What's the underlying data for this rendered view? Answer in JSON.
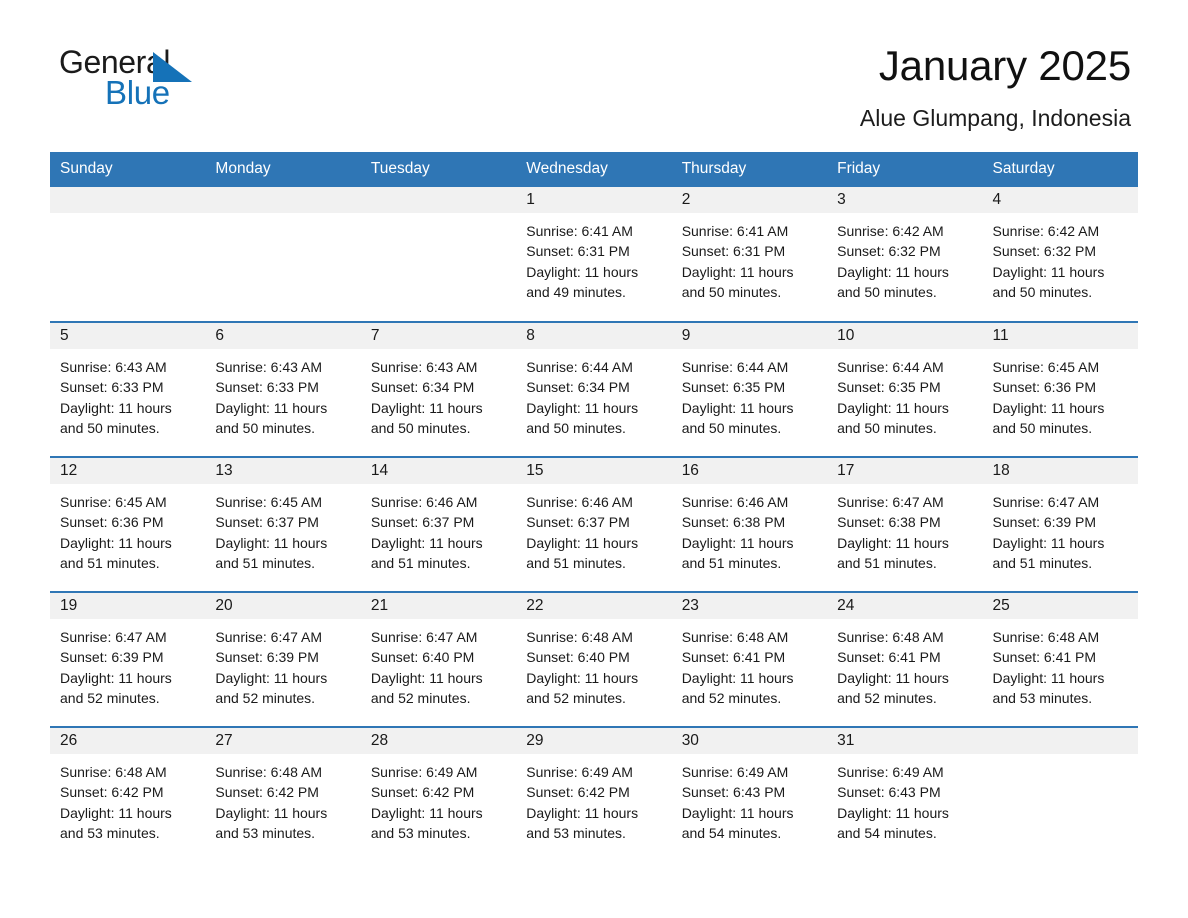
{
  "brand": {
    "name_part1": "General",
    "name_part2": "Blue",
    "triangle_icon": "triangle-icon",
    "accent_color": "#1572b8"
  },
  "header": {
    "month_title": "January 2025",
    "location": "Alue Glumpang, Indonesia",
    "header_bg_color": "#2f76b5",
    "row_divider_color": "#2f76b5",
    "daynum_band_color": "#f1f1f1"
  },
  "weekday_headers": [
    "Sunday",
    "Monday",
    "Tuesday",
    "Wednesday",
    "Thursday",
    "Friday",
    "Saturday"
  ],
  "labels": {
    "sunrise_prefix": "Sunrise:",
    "sunset_prefix": "Sunset:",
    "daylight_prefix": "Daylight:"
  },
  "weeks": [
    [
      {
        "day": "",
        "empty": true
      },
      {
        "day": "",
        "empty": true
      },
      {
        "day": "",
        "empty": true
      },
      {
        "day": "1",
        "sunrise": "Sunrise: 6:41 AM",
        "sunset": "Sunset: 6:31 PM",
        "daylight_line1": "Daylight: 11 hours",
        "daylight_line2": "and 49 minutes."
      },
      {
        "day": "2",
        "sunrise": "Sunrise: 6:41 AM",
        "sunset": "Sunset: 6:31 PM",
        "daylight_line1": "Daylight: 11 hours",
        "daylight_line2": "and 50 minutes."
      },
      {
        "day": "3",
        "sunrise": "Sunrise: 6:42 AM",
        "sunset": "Sunset: 6:32 PM",
        "daylight_line1": "Daylight: 11 hours",
        "daylight_line2": "and 50 minutes."
      },
      {
        "day": "4",
        "sunrise": "Sunrise: 6:42 AM",
        "sunset": "Sunset: 6:32 PM",
        "daylight_line1": "Daylight: 11 hours",
        "daylight_line2": "and 50 minutes."
      }
    ],
    [
      {
        "day": "5",
        "sunrise": "Sunrise: 6:43 AM",
        "sunset": "Sunset: 6:33 PM",
        "daylight_line1": "Daylight: 11 hours",
        "daylight_line2": "and 50 minutes."
      },
      {
        "day": "6",
        "sunrise": "Sunrise: 6:43 AM",
        "sunset": "Sunset: 6:33 PM",
        "daylight_line1": "Daylight: 11 hours",
        "daylight_line2": "and 50 minutes."
      },
      {
        "day": "7",
        "sunrise": "Sunrise: 6:43 AM",
        "sunset": "Sunset: 6:34 PM",
        "daylight_line1": "Daylight: 11 hours",
        "daylight_line2": "and 50 minutes."
      },
      {
        "day": "8",
        "sunrise": "Sunrise: 6:44 AM",
        "sunset": "Sunset: 6:34 PM",
        "daylight_line1": "Daylight: 11 hours",
        "daylight_line2": "and 50 minutes."
      },
      {
        "day": "9",
        "sunrise": "Sunrise: 6:44 AM",
        "sunset": "Sunset: 6:35 PM",
        "daylight_line1": "Daylight: 11 hours",
        "daylight_line2": "and 50 minutes."
      },
      {
        "day": "10",
        "sunrise": "Sunrise: 6:44 AM",
        "sunset": "Sunset: 6:35 PM",
        "daylight_line1": "Daylight: 11 hours",
        "daylight_line2": "and 50 minutes."
      },
      {
        "day": "11",
        "sunrise": "Sunrise: 6:45 AM",
        "sunset": "Sunset: 6:36 PM",
        "daylight_line1": "Daylight: 11 hours",
        "daylight_line2": "and 50 minutes."
      }
    ],
    [
      {
        "day": "12",
        "sunrise": "Sunrise: 6:45 AM",
        "sunset": "Sunset: 6:36 PM",
        "daylight_line1": "Daylight: 11 hours",
        "daylight_line2": "and 51 minutes."
      },
      {
        "day": "13",
        "sunrise": "Sunrise: 6:45 AM",
        "sunset": "Sunset: 6:37 PM",
        "daylight_line1": "Daylight: 11 hours",
        "daylight_line2": "and 51 minutes."
      },
      {
        "day": "14",
        "sunrise": "Sunrise: 6:46 AM",
        "sunset": "Sunset: 6:37 PM",
        "daylight_line1": "Daylight: 11 hours",
        "daylight_line2": "and 51 minutes."
      },
      {
        "day": "15",
        "sunrise": "Sunrise: 6:46 AM",
        "sunset": "Sunset: 6:37 PM",
        "daylight_line1": "Daylight: 11 hours",
        "daylight_line2": "and 51 minutes."
      },
      {
        "day": "16",
        "sunrise": "Sunrise: 6:46 AM",
        "sunset": "Sunset: 6:38 PM",
        "daylight_line1": "Daylight: 11 hours",
        "daylight_line2": "and 51 minutes."
      },
      {
        "day": "17",
        "sunrise": "Sunrise: 6:47 AM",
        "sunset": "Sunset: 6:38 PM",
        "daylight_line1": "Daylight: 11 hours",
        "daylight_line2": "and 51 minutes."
      },
      {
        "day": "18",
        "sunrise": "Sunrise: 6:47 AM",
        "sunset": "Sunset: 6:39 PM",
        "daylight_line1": "Daylight: 11 hours",
        "daylight_line2": "and 51 minutes."
      }
    ],
    [
      {
        "day": "19",
        "sunrise": "Sunrise: 6:47 AM",
        "sunset": "Sunset: 6:39 PM",
        "daylight_line1": "Daylight: 11 hours",
        "daylight_line2": "and 52 minutes."
      },
      {
        "day": "20",
        "sunrise": "Sunrise: 6:47 AM",
        "sunset": "Sunset: 6:39 PM",
        "daylight_line1": "Daylight: 11 hours",
        "daylight_line2": "and 52 minutes."
      },
      {
        "day": "21",
        "sunrise": "Sunrise: 6:47 AM",
        "sunset": "Sunset: 6:40 PM",
        "daylight_line1": "Daylight: 11 hours",
        "daylight_line2": "and 52 minutes."
      },
      {
        "day": "22",
        "sunrise": "Sunrise: 6:48 AM",
        "sunset": "Sunset: 6:40 PM",
        "daylight_line1": "Daylight: 11 hours",
        "daylight_line2": "and 52 minutes."
      },
      {
        "day": "23",
        "sunrise": "Sunrise: 6:48 AM",
        "sunset": "Sunset: 6:41 PM",
        "daylight_line1": "Daylight: 11 hours",
        "daylight_line2": "and 52 minutes."
      },
      {
        "day": "24",
        "sunrise": "Sunrise: 6:48 AM",
        "sunset": "Sunset: 6:41 PM",
        "daylight_line1": "Daylight: 11 hours",
        "daylight_line2": "and 52 minutes."
      },
      {
        "day": "25",
        "sunrise": "Sunrise: 6:48 AM",
        "sunset": "Sunset: 6:41 PM",
        "daylight_line1": "Daylight: 11 hours",
        "daylight_line2": "and 53 minutes."
      }
    ],
    [
      {
        "day": "26",
        "sunrise": "Sunrise: 6:48 AM",
        "sunset": "Sunset: 6:42 PM",
        "daylight_line1": "Daylight: 11 hours",
        "daylight_line2": "and 53 minutes."
      },
      {
        "day": "27",
        "sunrise": "Sunrise: 6:48 AM",
        "sunset": "Sunset: 6:42 PM",
        "daylight_line1": "Daylight: 11 hours",
        "daylight_line2": "and 53 minutes."
      },
      {
        "day": "28",
        "sunrise": "Sunrise: 6:49 AM",
        "sunset": "Sunset: 6:42 PM",
        "daylight_line1": "Daylight: 11 hours",
        "daylight_line2": "and 53 minutes."
      },
      {
        "day": "29",
        "sunrise": "Sunrise: 6:49 AM",
        "sunset": "Sunset: 6:42 PM",
        "daylight_line1": "Daylight: 11 hours",
        "daylight_line2": "and 53 minutes."
      },
      {
        "day": "30",
        "sunrise": "Sunrise: 6:49 AM",
        "sunset": "Sunset: 6:43 PM",
        "daylight_line1": "Daylight: 11 hours",
        "daylight_line2": "and 54 minutes."
      },
      {
        "day": "31",
        "sunrise": "Sunrise: 6:49 AM",
        "sunset": "Sunset: 6:43 PM",
        "daylight_line1": "Daylight: 11 hours",
        "daylight_line2": "and 54 minutes."
      },
      {
        "day": "",
        "empty": true
      }
    ]
  ]
}
